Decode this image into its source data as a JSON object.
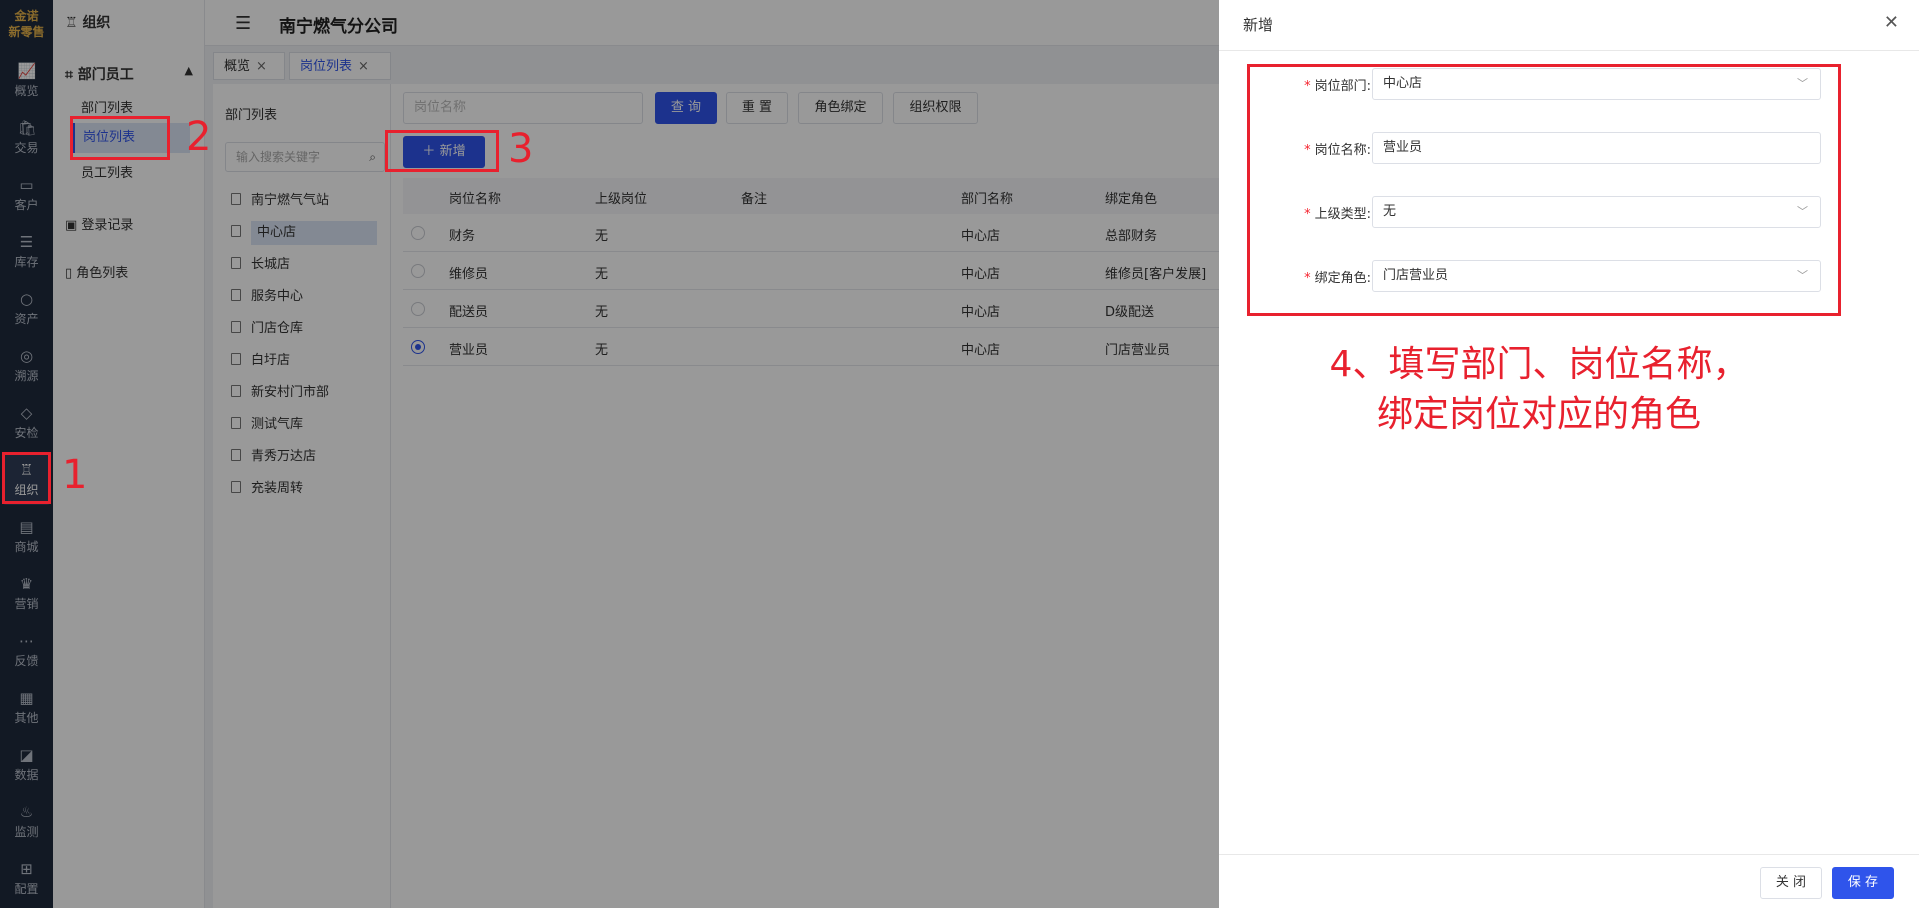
{
  "rail": {
    "logo_line1": "金诺",
    "logo_line2": "新零售",
    "items": [
      {
        "label": "概览",
        "icon": "chart-icon"
      },
      {
        "label": "交易",
        "icon": "bag-icon"
      },
      {
        "label": "客户",
        "icon": "id-card-icon"
      },
      {
        "label": "库存",
        "icon": "list-icon"
      },
      {
        "label": "资产",
        "icon": "bulb-icon"
      },
      {
        "label": "溯源",
        "icon": "compass-icon"
      },
      {
        "label": "安检",
        "icon": "shield-icon"
      },
      {
        "label": "组织",
        "icon": "org-icon"
      },
      {
        "label": "商城",
        "icon": "store-icon"
      },
      {
        "label": "营销",
        "icon": "trophy-icon"
      },
      {
        "label": "反馈",
        "icon": "chat-icon"
      },
      {
        "label": "其他",
        "icon": "blocks-icon"
      },
      {
        "label": "数据",
        "icon": "data-icon"
      },
      {
        "label": "监测",
        "icon": "alarm-icon"
      },
      {
        "label": "配置",
        "icon": "grid-icon"
      }
    ]
  },
  "menu": {
    "title": "组织",
    "group": "部门员工",
    "subs": [
      "部门列表",
      "岗位列表",
      "员工列表"
    ],
    "login_records": "登录记录",
    "role_list": "角色列表"
  },
  "header": {
    "company": "南宁燃气分公司"
  },
  "tabs": [
    {
      "label": "概览",
      "close": "×"
    },
    {
      "label": "岗位列表",
      "close": "×"
    }
  ],
  "dept": {
    "heading": "部门列表",
    "search_placeholder": "输入搜索关键字",
    "nodes": [
      "南宁燃气气站",
      "中心店",
      "长城店",
      "服务中心",
      "门店仓库",
      "白圩店",
      "新安村门市部",
      "测试气库",
      "青秀万达店",
      "充装周转"
    ]
  },
  "toolbar": {
    "position_placeholder": "岗位名称",
    "query": "查 询",
    "reset": "重 置",
    "bind_role": "角色绑定",
    "org_perm": "组织权限",
    "add": "新增"
  },
  "table": {
    "columns": [
      "岗位名称",
      "上级岗位",
      "备注",
      "部门名称",
      "绑定角色"
    ],
    "rows": [
      {
        "name": "财务",
        "parent": "无",
        "note": "",
        "dept": "中心店",
        "role": "总部财务",
        "selected": false
      },
      {
        "name": "维修员",
        "parent": "无",
        "note": "",
        "dept": "中心店",
        "role": "维修员[客户发展]",
        "selected": false
      },
      {
        "name": "配送员",
        "parent": "无",
        "note": "",
        "dept": "中心店",
        "role": "D级配送",
        "selected": false
      },
      {
        "name": "营业员",
        "parent": "无",
        "note": "",
        "dept": "中心店",
        "role": "门店营业员",
        "selected": true
      }
    ]
  },
  "drawer": {
    "title": "新增",
    "fields": [
      {
        "label": "岗位部门:",
        "value": "中心店",
        "type": "select"
      },
      {
        "label": "岗位名称:",
        "value": "营业员",
        "type": "input"
      },
      {
        "label": "上级类型:",
        "value": "无",
        "type": "select"
      },
      {
        "label": "绑定角色:",
        "value": "门店营业员",
        "type": "select"
      }
    ],
    "close_btn": "关 闭",
    "save_btn": "保 存"
  },
  "annotations": {
    "n1": "1",
    "n2": "2",
    "n3": "3",
    "note_line1": "4、填写部门、岗位名称，",
    "note_line2": "绑定岗位对应的角色"
  },
  "colors": {
    "primary": "#2f54eb",
    "rail_bg": "#1f2a3c",
    "annotation_red": "#e8212e",
    "required_star": "#f5222d"
  }
}
